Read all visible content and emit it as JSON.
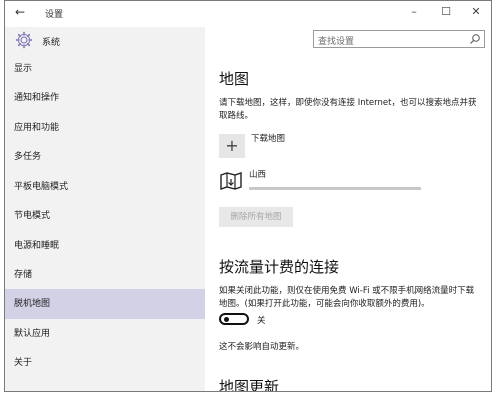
{
  "window": {
    "back_glyph": "←",
    "title": "设置",
    "minimize_glyph": "–",
    "maximize_glyph": "☐",
    "close_glyph": "✕"
  },
  "sidebar": {
    "header_icon": "gear-icon",
    "header_label": "系统",
    "items": [
      {
        "label": "显示"
      },
      {
        "label": "通知和操作"
      },
      {
        "label": "应用和功能"
      },
      {
        "label": "多任务"
      },
      {
        "label": "平板电脑模式"
      },
      {
        "label": "节电模式"
      },
      {
        "label": "电源和睡眠"
      },
      {
        "label": "存储"
      },
      {
        "label": "脱机地图",
        "selected": true
      },
      {
        "label": "默认应用"
      },
      {
        "label": "关于"
      }
    ]
  },
  "search": {
    "placeholder": "查找设置",
    "icon": "search-icon"
  },
  "maps": {
    "title": "地图",
    "description": "请下载地图，这样，即使你没有连接 Internet，也可以搜索地点并获取路线。",
    "download_button_glyph": "+",
    "download_label": "下载地图",
    "region_icon": "map-icon",
    "region_name": "山西",
    "region_progress": 0,
    "delete_all_label": "删除所有地图"
  },
  "metered": {
    "title": "按流量计费的连接",
    "description": "如果关闭此功能，则仅在使用免费 Wi-Fi 或不限手机网络流量时下载地图。(如果打开此功能，可能会向你收取额外的费用)。",
    "toggle_state": "关",
    "toggle_on": false
  },
  "note": "这不会影响自动更新。",
  "updates": {
    "title": "地图更新"
  }
}
